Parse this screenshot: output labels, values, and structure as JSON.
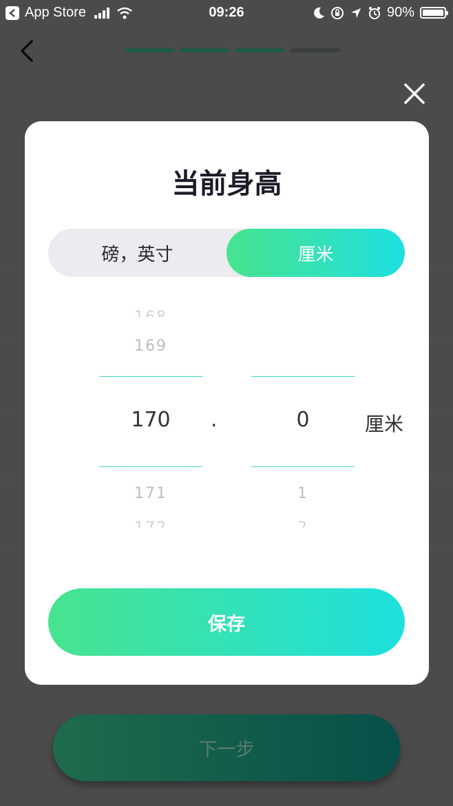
{
  "status_bar": {
    "app": "App Store",
    "time": "09:26",
    "battery": "90%",
    "battery_level": 0.9
  },
  "progress_steps": {
    "total": 4,
    "completed": 3
  },
  "next_button_label": "下一步",
  "modal": {
    "title": "当前身高",
    "unit_toggle": {
      "options": [
        "磅，英寸",
        "厘米"
      ],
      "selected": "厘米"
    },
    "integer_picker": {
      "above_far": "168",
      "above": "169",
      "selected": "170",
      "below": "171",
      "below_far": "172"
    },
    "decimal_separator": ".",
    "decimal_picker": {
      "selected": "0",
      "below": "1",
      "below_far": "2"
    },
    "unit_label": "厘米",
    "save_label": "保存"
  },
  "colors": {
    "accent_start": "#48e38f",
    "accent_end": "#1ee0df",
    "overlay": "#4b4b4b"
  }
}
